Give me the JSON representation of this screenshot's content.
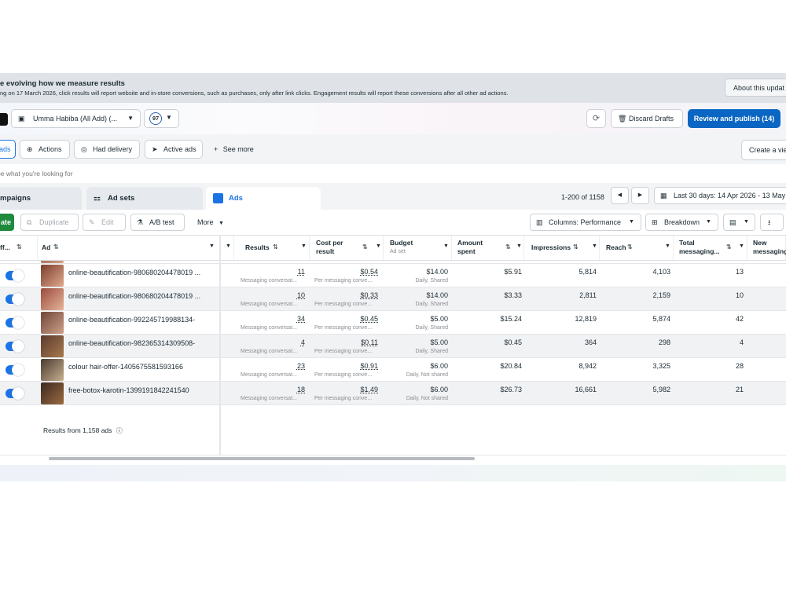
{
  "banner": {
    "title": "e evolving how we measure results",
    "text": "ng on 17 March 2026, click results will report website and in-store conversions, such as purchases, only after link clicks. Engagement results will report these conversions after all other ad actions.",
    "about_button": "About this updat"
  },
  "toolbar": {
    "account": "Umma Habiba (All Add) (...",
    "issues_count": "97",
    "discard_label": "Discard Drafts",
    "publish_label": "Review and publish (14)"
  },
  "filters": {
    "chip_ads": "ads",
    "actions": "Actions",
    "had_delivery": "Had delivery",
    "active_ads": "Active ads",
    "see_more": "See more",
    "create_view": "Create a vie"
  },
  "search": {
    "placeholder": "pe what you're looking for"
  },
  "tabs": {
    "campaigns": "mpaigns",
    "ad_sets": "Ad sets",
    "ads": "Ads"
  },
  "pager": {
    "range": "1-200 of 1158",
    "date_range": "Last 30 days: 14 Apr 2026 - 13 May"
  },
  "actions": {
    "create": "ate",
    "duplicate": "Duplicate",
    "edit": "Edit",
    "ab_test": "A/B test",
    "more": "More",
    "columns": "Columns: Performance",
    "breakdown": "Breakdown"
  },
  "columns": {
    "off": "ff...",
    "ad": "Ad",
    "results": "Results",
    "cost_per_result_1": "Cost per",
    "cost_per_result_2": "result",
    "budget": "Budget",
    "budget_sub": "Ad set",
    "amount_1": "Amount",
    "amount_2": "spent",
    "impressions": "Impressions",
    "reach": "Reach",
    "total_1": "Total",
    "total_2": "messaging...",
    "new_1": "New",
    "new_2": "messaging"
  },
  "rows": [
    {
      "name": "online-beautification-980680204478019 ...",
      "results": "11",
      "results_sub": "Messaging conversat...",
      "cpr": "$0.54",
      "cpr_sub": "Per messaging conve...",
      "budget": "$14.00",
      "budget_sub": "Daily, Shared",
      "spent": "$5.91",
      "impressions": "5,814",
      "reach": "4,103",
      "total": "13"
    },
    {
      "name": "online-beautification-980680204478019 ...",
      "results": "10",
      "results_sub": "Messaging conversat...",
      "cpr": "$0.33",
      "cpr_sub": "Per messaging conve...",
      "budget": "$14.00",
      "budget_sub": "Daily, Shared",
      "spent": "$3.33",
      "impressions": "2,811",
      "reach": "2,159",
      "total": "10"
    },
    {
      "name": "online-beautification-992245719988134-",
      "results": "34",
      "results_sub": "Messaging conversat...",
      "cpr": "$0.45",
      "cpr_sub": "Per messaging conve...",
      "budget": "$5.00",
      "budget_sub": "Daily, Shared",
      "spent": "$15.24",
      "impressions": "12,819",
      "reach": "5,874",
      "total": "42"
    },
    {
      "name": "online-beautification-982365314309508-",
      "results": "4",
      "results_sub": "Messaging conversat...",
      "cpr": "$0.11",
      "cpr_sub": "Per messaging conve...",
      "budget": "$5.00",
      "budget_sub": "Daily, Shared",
      "spent": "$0.45",
      "impressions": "364",
      "reach": "298",
      "total": "4"
    },
    {
      "name": "colour hair-offer-1405675581593166",
      "results": "23",
      "results_sub": "Messaging conversat...",
      "cpr": "$0.91",
      "cpr_sub": "Per messaging conve...",
      "budget": "$6.00",
      "budget_sub": "Daily, Not shared",
      "spent": "$20.84",
      "impressions": "8,942",
      "reach": "3,325",
      "total": "28"
    },
    {
      "name": "free-botox-karotin-1399191842241540",
      "results": "18",
      "results_sub": "Messaging conversat...",
      "cpr": "$1.49",
      "cpr_sub": "Per messaging conve...",
      "budget": "$6.00",
      "budget_sub": "Daily, Not shared",
      "spent": "$26.73",
      "impressions": "16,661",
      "reach": "5,982",
      "total": "21"
    }
  ],
  "footer": {
    "results_note": "Results from 1,158 ads"
  },
  "colors": {
    "primary": "#0a66c2",
    "create": "#1e8a3c",
    "toggle": "#1b74e4"
  }
}
